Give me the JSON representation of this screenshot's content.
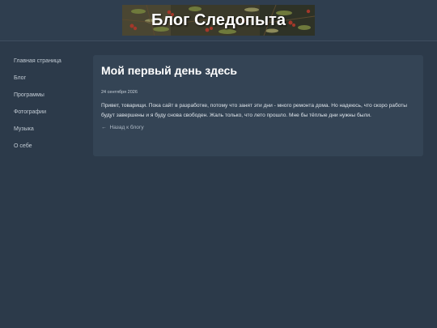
{
  "header": {
    "title": "Блог Следопыта",
    "banner_icon": "berries-branch-photo"
  },
  "sidebar": {
    "items": [
      {
        "label": "Главная страница"
      },
      {
        "label": "Блог"
      },
      {
        "label": "Программы"
      },
      {
        "label": "Фотографии"
      },
      {
        "label": "Музыка"
      },
      {
        "label": "О себе"
      }
    ]
  },
  "post": {
    "title": "Мой первый день здесь",
    "date": "24 сентября 2026",
    "body": "Привет, товарищи. Пока сайт в разработке, потому что занят эти дни - много ремонта дома. Но надеюсь, что скоро работы будут завершены и я буду снова свободен. Жаль только, что лето прошло. Мне бы тёплые дни нужны были.",
    "back_arrow": "←",
    "back_label": "Назад к блогу"
  },
  "colors": {
    "background": "#2c3a4a",
    "header": "#2f3e4f",
    "card": "#344455",
    "text": "#dfe5eb",
    "nav_text": "#c2cbd4"
  }
}
